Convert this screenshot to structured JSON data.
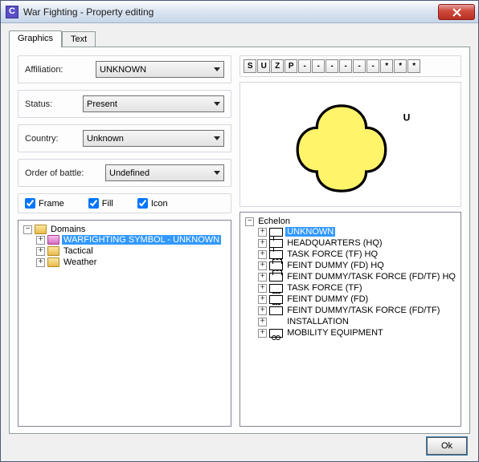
{
  "window": {
    "title": "War Fighting - Property editing"
  },
  "tabs": {
    "graphics": "Graphics",
    "text": "Text"
  },
  "fields": {
    "affiliation_label": "Affiliation:",
    "affiliation_value": "UNKNOWN",
    "status_label": "Status:",
    "status_value": "Present",
    "country_label": "Country:",
    "country_value": "Unknown",
    "oob_label": "Order of battle:",
    "oob_value": "Undefined"
  },
  "checks": {
    "frame": "Frame",
    "fill": "Fill",
    "icon": "Icon"
  },
  "code": [
    "S",
    "U",
    "Z",
    "P",
    "-",
    "-",
    "-",
    "-",
    "-",
    "-",
    "*",
    "*",
    "*"
  ],
  "preview": {
    "letter": "U",
    "fill": "#fff46a",
    "stroke": "#000000"
  },
  "domains": {
    "root": "Domains",
    "items": [
      {
        "label": "WARFIGHTING SYMBOL - UNKNOWN",
        "selected": true,
        "special": true
      },
      {
        "label": "Tactical"
      },
      {
        "label": "Weather"
      }
    ]
  },
  "echelon": {
    "root": "Echelon",
    "items": [
      {
        "label": "UNKNOWN",
        "selected": true,
        "icon": "rect"
      },
      {
        "label": "HEADQUARTERS (HQ)",
        "icon": "flag"
      },
      {
        "label": "TASK FORCE (TF) HQ",
        "icon": "flag"
      },
      {
        "label": "FEINT DUMMY (FD) HQ",
        "icon": "flagdash"
      },
      {
        "label": "FEINT DUMMY/TASK FORCE (FD/TF) HQ",
        "icon": "flagdash"
      },
      {
        "label": "TASK FORCE (TF)",
        "icon": "rect"
      },
      {
        "label": "FEINT DUMMY (FD)",
        "icon": "dash"
      },
      {
        "label": "FEINT DUMMY/TASK FORCE (FD/TF)",
        "icon": "dash"
      },
      {
        "label": "INSTALLATION",
        "icon": "none"
      },
      {
        "label": "MOBILITY EQUIPMENT",
        "icon": "wheel"
      }
    ]
  },
  "buttons": {
    "ok": "Ok"
  }
}
